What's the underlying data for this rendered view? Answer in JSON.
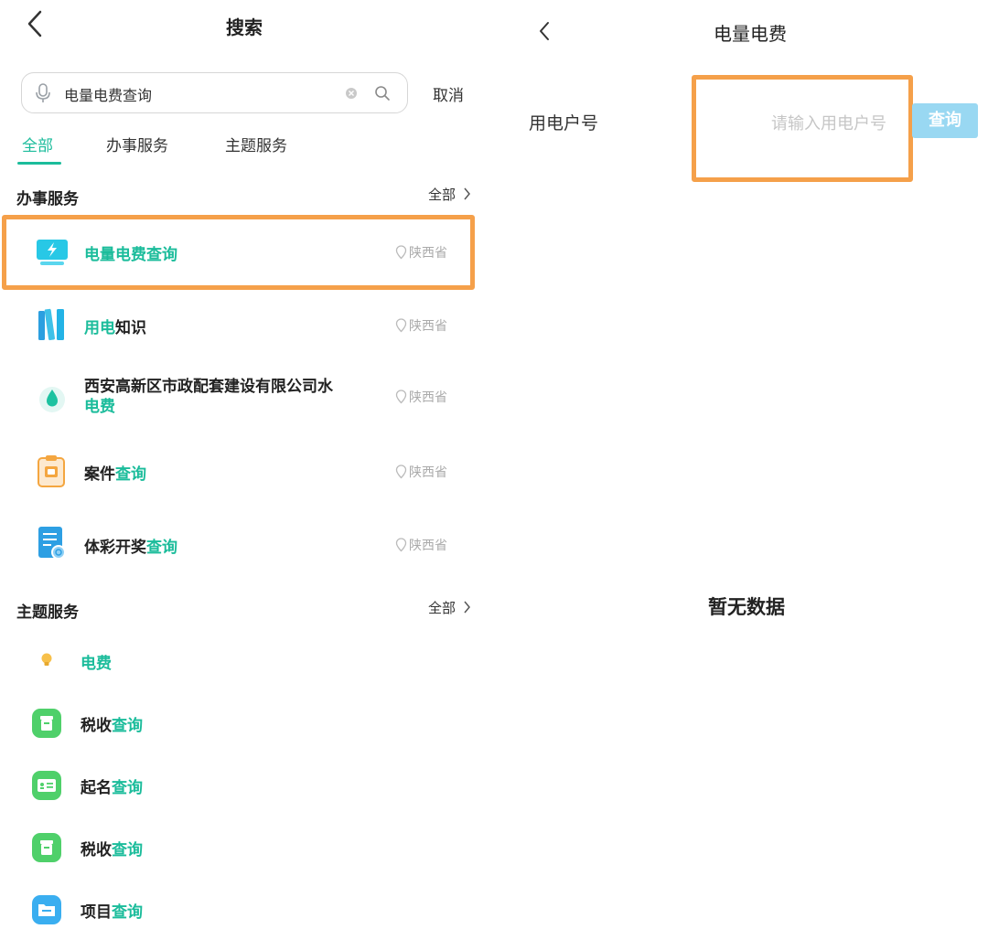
{
  "left": {
    "title": "搜索",
    "search": {
      "value": "电量电费查询"
    },
    "cancel_label": "取消",
    "tabs": [
      {
        "label": "全部",
        "active": true
      },
      {
        "label": "办事服务",
        "active": false
      },
      {
        "label": "主题服务",
        "active": false
      }
    ],
    "service_section": {
      "title": "办事服务",
      "all_label": "全部",
      "items": [
        {
          "pre": "",
          "hl": "电量电费查询",
          "post": "",
          "hl2": "",
          "location": "陕西省",
          "icon": "monitor-lightning-icon"
        },
        {
          "pre": "",
          "hl": "用电",
          "post": "知识",
          "hl2": "",
          "location": "陕西省",
          "icon": "books-icon"
        },
        {
          "pre": "西安高新区市政配套建设有限公司水",
          "hl": "",
          "post": "",
          "hl2": "电费",
          "location": "陕西省",
          "icon": "water-drop-icon"
        },
        {
          "pre": "案件",
          "hl": "查询",
          "post": "",
          "hl2": "",
          "location": "陕西省",
          "icon": "clipboard-icon"
        },
        {
          "pre": "体彩开奖",
          "hl": "查询",
          "post": "",
          "hl2": "",
          "location": "陕西省",
          "icon": "document-search-icon"
        }
      ]
    },
    "topic_section": {
      "title": "主题服务",
      "all_label": "全部",
      "items": [
        {
          "pre": "",
          "hl": "电费",
          "icon": "lightbulb-icon"
        },
        {
          "pre": "税收",
          "hl": "查询",
          "icon": "tax-box-icon"
        },
        {
          "pre": "起名",
          "hl": "查询",
          "icon": "id-card-icon"
        },
        {
          "pre": "税收",
          "hl": "查询",
          "icon": "tax-box-icon"
        },
        {
          "pre": "项目",
          "hl": "查询",
          "icon": "folder-icon"
        }
      ]
    }
  },
  "right": {
    "title": "电量电费",
    "field_label": "用电户号",
    "field_placeholder": "请输入用电户号",
    "query_label": "查询",
    "empty_text": "暂无数据"
  },
  "colors": {
    "accent": "#1bbc9b",
    "highlight_border": "#f5a04a",
    "query_button": "#99d8f2"
  }
}
